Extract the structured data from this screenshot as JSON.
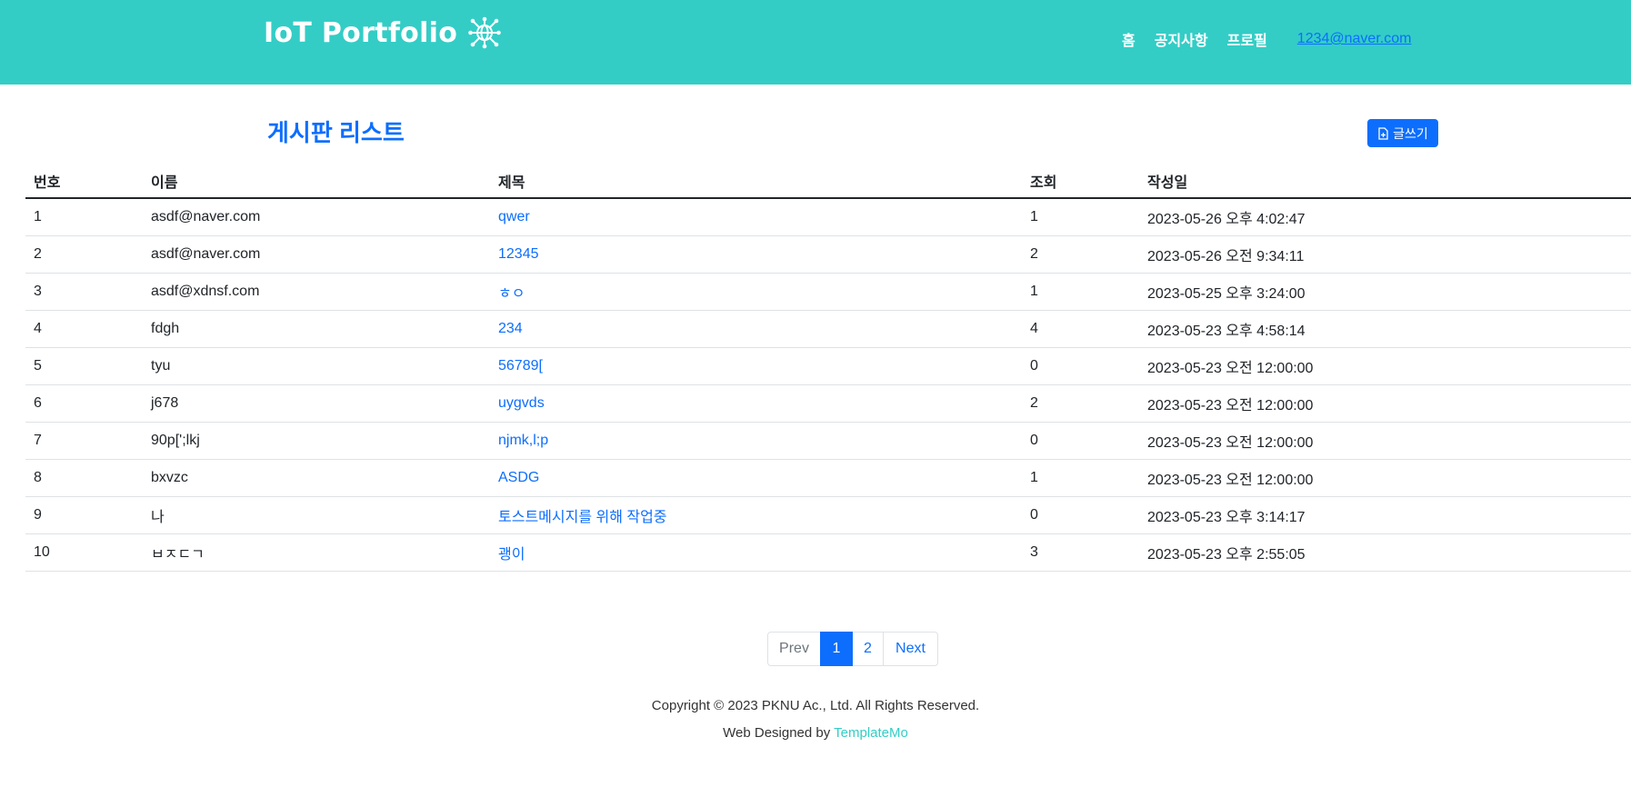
{
  "header": {
    "brand": "IoT Portfolio",
    "brand_icon": "globe-network-icon",
    "nav": [
      "홈",
      "공지사항",
      "프로필"
    ],
    "user_email": "1234@naver.com",
    "bg_color": "#33cdc6"
  },
  "board": {
    "title": "게시판 리스트",
    "write_label": "글쓰기",
    "write_icon": "file-plus-icon",
    "columns": [
      "번호",
      "이름",
      "제목",
      "조회",
      "작성일"
    ],
    "rows": [
      [
        "1",
        "asdf@naver.com",
        "qwer",
        "1",
        "2023-05-26 오후 4:02:47"
      ],
      [
        "2",
        "asdf@naver.com",
        "12345",
        "2",
        "2023-05-26 오전 9:34:11"
      ],
      [
        "3",
        "asdf@xdnsf.com",
        "ㅎㅇ",
        "1",
        "2023-05-25 오후 3:24:00"
      ],
      [
        "4",
        "fdgh",
        "234",
        "4",
        "2023-05-23 오후 4:58:14"
      ],
      [
        "5",
        "tyu",
        "56789[",
        "0",
        "2023-05-23 오전 12:00:00"
      ],
      [
        "6",
        "j678",
        "uygvds",
        "2",
        "2023-05-23 오전 12:00:00"
      ],
      [
        "7",
        "90p[';lkj",
        "njmk,l;p",
        "0",
        "2023-05-23 오전 12:00:00"
      ],
      [
        "8",
        "bxvzc",
        "ASDG",
        "1",
        "2023-05-23 오전 12:00:00"
      ],
      [
        "9",
        "나",
        "토스트메시지를 위해 작업중",
        "0",
        "2023-05-23 오후 3:14:17"
      ],
      [
        "10",
        "ㅂㅈㄷㄱ",
        "괭이",
        "3",
        "2023-05-23 오후 2:55:05"
      ]
    ]
  },
  "pagination": {
    "prev": "Prev",
    "pages": [
      "1",
      "2"
    ],
    "current": "1",
    "next": "Next"
  },
  "footer": {
    "copyright": "Copyright © 2023 PKNU Ac., Ltd. All Rights Reserved.",
    "designed_by": "Web Designed by",
    "credit": "TemplateMo"
  },
  "colors": {
    "accent": "#0d6efd",
    "brand": "#33cdc6"
  }
}
